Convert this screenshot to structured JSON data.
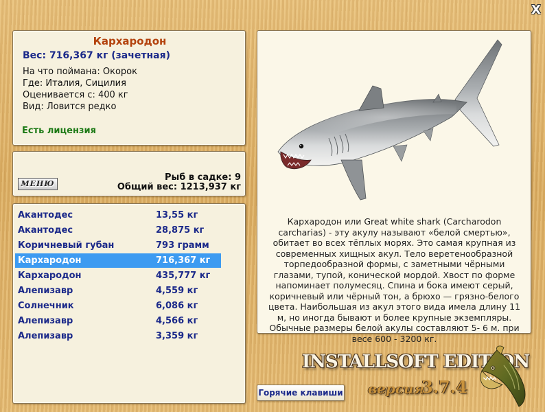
{
  "window": {
    "close_icon": "close-icon",
    "close_glyph": "X"
  },
  "fish": {
    "title": "Кархародон",
    "weight": "Вес: 716,367 кг (зачетная)",
    "bait": "На что поймана: Окорок",
    "place": "Где: Италия, Сицилия",
    "value": "Оценивается с: 400 кг",
    "kind": "Вид: Ловится редко",
    "license": "Есть лицензия"
  },
  "stats": {
    "menu_label": "МЕНЮ",
    "count": "Рыб в садке: 9",
    "total": "Общий вес: 1213,937 кг"
  },
  "catch_list": [
    {
      "name": "Акантодес",
      "weight": "13,55 кг"
    },
    {
      "name": "Акантодес",
      "weight": "28,875 кг"
    },
    {
      "name": "Коричневый губан",
      "weight": "793 грамм"
    },
    {
      "name": "Кархародон",
      "weight": "716,367 кг",
      "selected": true
    },
    {
      "name": "Кархародон",
      "weight": "435,777 кг"
    },
    {
      "name": "Алепизавр",
      "weight": "4,559 кг"
    },
    {
      "name": "Солнечник",
      "weight": "6,086 кг"
    },
    {
      "name": "Алепизавр",
      "weight": "4,566 кг"
    },
    {
      "name": "Алепизавр",
      "weight": "3,359 кг"
    }
  ],
  "colors": {
    "selected_row": "#3d9bf1",
    "title": "#b3420d",
    "list_text": "#1c2a8a",
    "license": "#1d7a16"
  },
  "description": "Кархародон или Great white shark (Carcharodon carcharias) - эту акулу называют «белой смертью», обитает во всех тёплых морях. Это самая крупная из современных хищных акул. Тело веретенообразной торпедообразной формы, с заметными чёрными глазами, тупой, конической мордой. Хвост по форме напоминает полумесяц. Спина и бока имеют серый, коричневый или чёрный тон, а брюхо — грязно-белого цвета. Наибольшая из акул этого вида имела длину 11 м, но иногда бывают и более крупные экземпляры. Обычные размеры белой акулы составляют 5- 6 м. при весе 600 - 3200 кг.",
  "footer": {
    "hotkeys_label": "Горячие клавиши",
    "edition": "INSTALLSOFT EDITION",
    "version_label": "версия",
    "version": "3.7.4"
  }
}
